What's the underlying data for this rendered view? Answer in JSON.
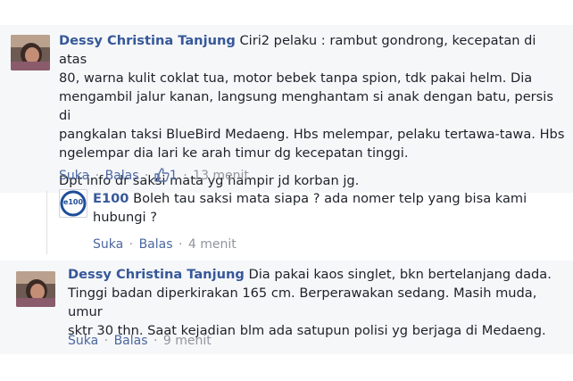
{
  "comments": [
    {
      "author": "Dessy Christina Tanjung",
      "lines": [
        " Ciri2 pelaku : rambut gondrong, kecepatan di atas",
        "80, warna kulit coklat tua, motor bebek tanpa spion, tdk pakai helm. Dia",
        "mengambil jalur kanan, langsung menghantam si anak dengan batu, persis di",
        "pangkalan taksi BlueBird Medaeng. Hbs melempar, pelaku tertawa-tawa. Hbs",
        "ngelempar dia lari ke arah timur dg kecepatan tinggi."
      ],
      "extra": "Dpt info dr saksi mata yg hampir jd korban jg.",
      "like": "Suka",
      "reply": "Balas",
      "like_count": "1",
      "time": "13 menit"
    },
    {
      "author": "E100",
      "avatar_text": "e100",
      "lines": [
        " Boleh tau saksi mata siapa ? ada nomer telp yang bisa kami",
        "hubungi ?"
      ],
      "like": "Suka",
      "reply": "Balas",
      "time": "4 menit"
    },
    {
      "author": "Dessy Christina Tanjung",
      "lines": [
        " Dia pakai kaos singlet, bkn bertelanjang dada.",
        "Tinggi badan diperkirakan 165 cm. Berperawakan sedang. Masih muda, umur",
        "sktr 30 thn. Saat kejadian blm ada satupun polisi yg berjaga di Medaeng."
      ],
      "like": "Suka",
      "reply": "Balas",
      "time": "9 menit"
    }
  ],
  "colors": {
    "name": "#365899",
    "meta": "#90949c",
    "bg_highlight": "#f6f7f9",
    "e100_blue": "#1f4e99"
  }
}
